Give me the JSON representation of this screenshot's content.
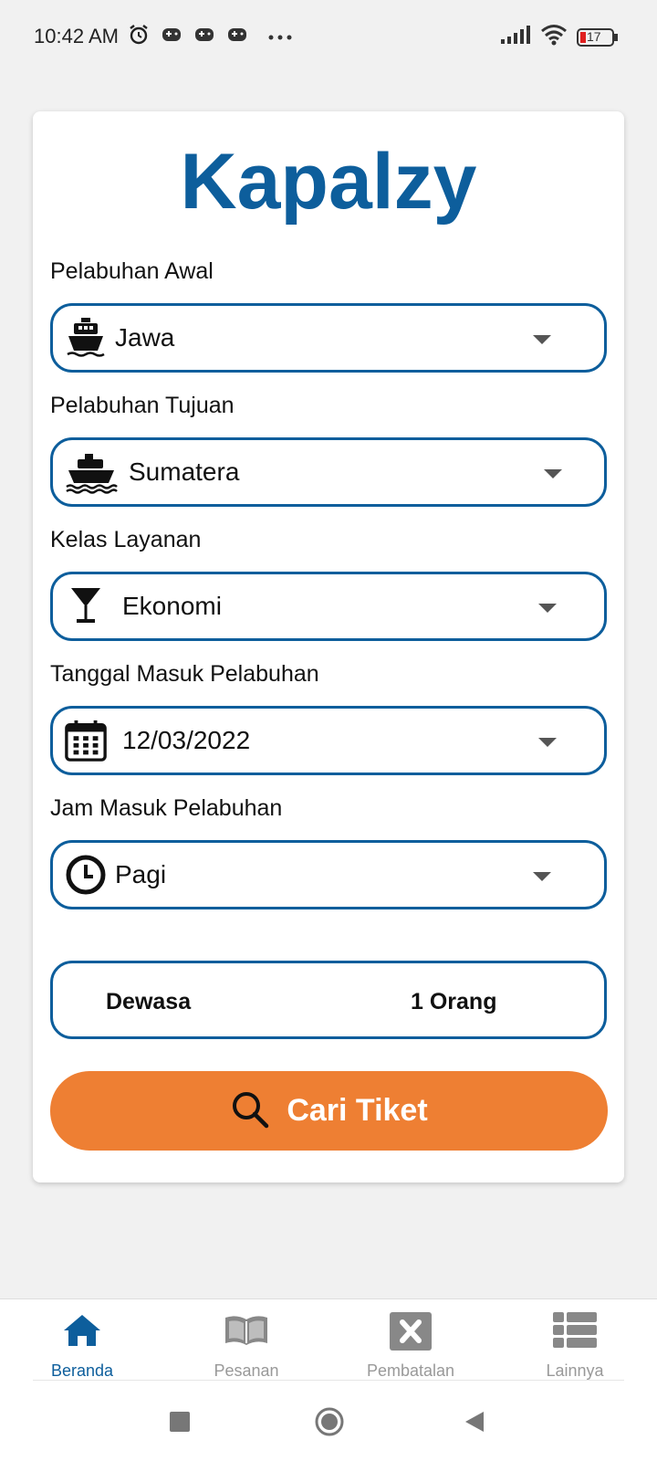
{
  "status_bar": {
    "time": "10:42 AM",
    "left_icons": [
      "alarm-icon",
      "game-icon",
      "game-icon",
      "game-icon",
      "more-dots-icon"
    ],
    "right_icons": [
      "signal-icon",
      "wifi-icon",
      "battery-icon"
    ],
    "battery_level": "17"
  },
  "app": {
    "title": "Kapalzy",
    "brand_color": "#0d5e9c",
    "accent_color": "#ee7f33"
  },
  "form": {
    "origin": {
      "label": "Pelabuhan Awal",
      "value": "Jawa",
      "icon": "ship-icon"
    },
    "destination": {
      "label": "Pelabuhan Tujuan",
      "value": "Sumatera",
      "icon": "ferry-icon"
    },
    "service_class": {
      "label": "Kelas Layanan",
      "value": "Ekonomi",
      "icon": "cocktail-icon"
    },
    "date": {
      "label": "Tanggal Masuk Pelabuhan",
      "value": "12/03/2022",
      "icon": "calendar-icon"
    },
    "time": {
      "label": "Jam Masuk Pelabuhan",
      "value": "Pagi",
      "icon": "clock-icon"
    },
    "passengers": {
      "label": "Dewasa",
      "value": "1 Orang"
    },
    "search_button": {
      "label": "Cari Tiket",
      "icon": "search-icon"
    }
  },
  "bottom_nav": {
    "items": [
      {
        "label": "Beranda",
        "icon": "home-icon",
        "active": true
      },
      {
        "label": "Pesanan",
        "icon": "book-icon",
        "active": false
      },
      {
        "label": "Pembatalan",
        "icon": "cancel-icon",
        "active": false
      },
      {
        "label": "Lainnya",
        "icon": "list-icon",
        "active": false
      }
    ]
  },
  "system_nav": {
    "buttons": [
      "recents-button",
      "home-button",
      "back-button"
    ]
  }
}
